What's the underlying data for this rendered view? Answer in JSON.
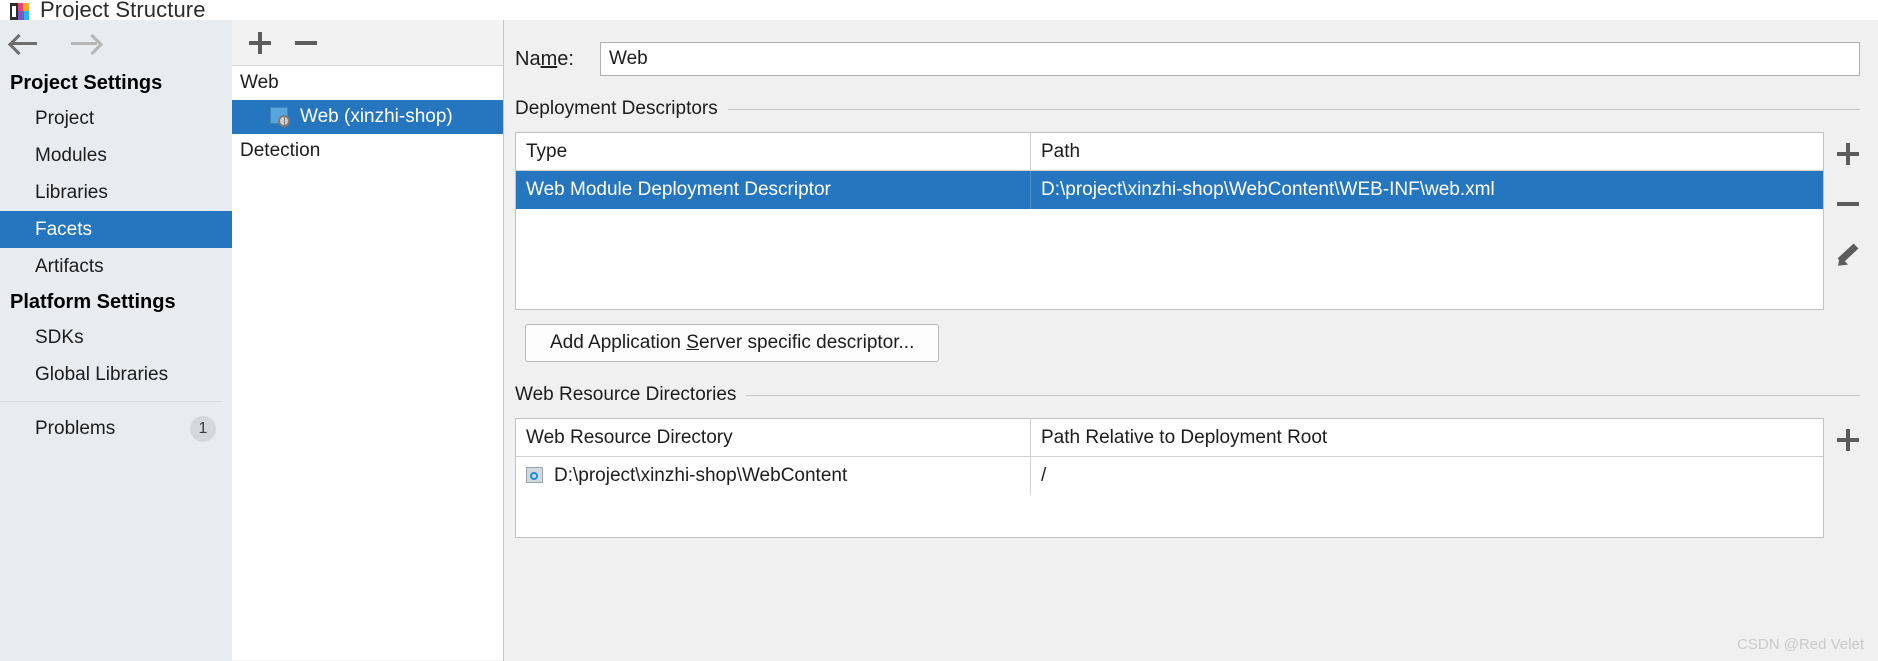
{
  "window": {
    "title": "Project Structure",
    "app_icon": "intellij-idea-icon"
  },
  "nav_toolbar": {
    "back_icon": "arrow-left-icon",
    "forward_icon": "arrow-right-icon"
  },
  "sidebar": {
    "groups": [
      {
        "title": "Project Settings",
        "items": [
          {
            "label": "Project",
            "selected": false
          },
          {
            "label": "Modules",
            "selected": false
          },
          {
            "label": "Libraries",
            "selected": false
          },
          {
            "label": "Facets",
            "selected": true
          },
          {
            "label": "Artifacts",
            "selected": false
          }
        ]
      },
      {
        "title": "Platform Settings",
        "items": [
          {
            "label": "SDKs",
            "selected": false
          },
          {
            "label": "Global Libraries",
            "selected": false
          }
        ]
      }
    ],
    "problems": {
      "label": "Problems",
      "badge": "1"
    }
  },
  "facet_panel": {
    "toolbar": {
      "add_icon": "plus-icon",
      "remove_icon": "minus-icon"
    },
    "tree": [
      {
        "label": "Web",
        "type": "group",
        "selected": false
      },
      {
        "label": "Web (xinzhi-shop)",
        "type": "facet",
        "icon": "web-facet-icon",
        "selected": true
      },
      {
        "label": "Detection",
        "type": "group",
        "selected": false
      }
    ]
  },
  "main": {
    "name_field": {
      "label_before": "Na",
      "label_mnemonic": "m",
      "label_after": "e:",
      "value": "Web",
      "placeholder": "Web"
    },
    "deployment_descriptors": {
      "title": "Deployment Descriptors",
      "columns": [
        "Type",
        "Path"
      ],
      "rows": [
        {
          "type": "Web Module Deployment Descriptor",
          "path": "D:\\project\\xinzhi-shop\\WebContent\\WEB-INF\\web.xml",
          "selected": true
        }
      ],
      "tools": [
        "plus-icon",
        "minus-icon",
        "pencil-icon"
      ],
      "add_button": {
        "before": "Add Application ",
        "mnemonic": "S",
        "after": "erver specific descriptor..."
      }
    },
    "web_resource_directories": {
      "title": "Web Resource Directories",
      "columns": [
        "Web Resource Directory",
        "Path Relative to Deployment Root"
      ],
      "rows": [
        {
          "directory": "D:\\project\\xinzhi-shop\\WebContent",
          "relative_path": "/",
          "icon": "folder-resource-icon"
        }
      ],
      "tools": [
        "plus-icon"
      ]
    }
  },
  "watermark": {
    "text": "CSDN @Red Velet"
  },
  "colors": {
    "selection": "#2675bf",
    "sidebar_bg": "#e8ecef",
    "panel_bg": "#f0f0f0"
  }
}
